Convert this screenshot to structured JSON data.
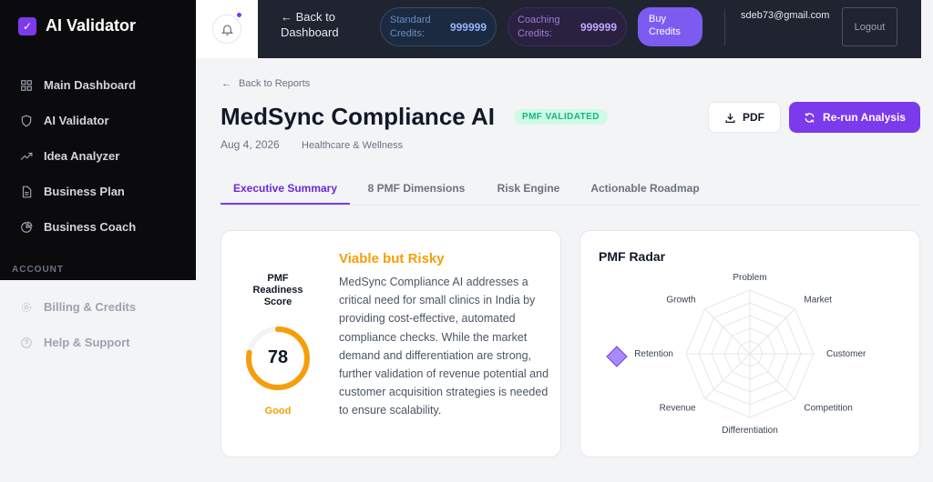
{
  "brand": {
    "name": "AI Validator",
    "logo_icon": "check-icon"
  },
  "sidebar": {
    "items": [
      {
        "label": "Main Dashboard",
        "icon": "grid-icon"
      },
      {
        "label": "AI Validator",
        "icon": "shield-icon"
      },
      {
        "label": "Idea Analyzer",
        "icon": "trend-icon"
      },
      {
        "label": "Business Plan",
        "icon": "document-icon"
      },
      {
        "label": "Business Coach",
        "icon": "pie-icon"
      }
    ],
    "section_label": "ACCOUNT",
    "account_items": [
      {
        "label": "Billing & Credits",
        "icon": "gear-icon"
      },
      {
        "label": "Help & Support",
        "icon": "help-icon"
      }
    ]
  },
  "header": {
    "back_label": "← Back to Dashboard",
    "standard_credits_label": "Standard Credits:",
    "standard_credits_value": "999999",
    "coaching_credits_label": "Coaching Credits:",
    "coaching_credits_value": "999999",
    "buy_label": "Buy Credits",
    "email": "sdeb73@gmail.com",
    "logout_label": "Logout"
  },
  "report": {
    "back_label": "Back to Reports",
    "title": "MedSync Compliance AI",
    "badge": "PMF VALIDATED",
    "date": "Aug 4, 2026",
    "category": "Healthcare & Wellness",
    "pdf_label": "PDF",
    "rerun_label": "Re-run Analysis"
  },
  "tabs": [
    {
      "label": "Executive Summary",
      "active": true
    },
    {
      "label": "8 PMF Dimensions",
      "active": false
    },
    {
      "label": "Risk Engine",
      "active": false
    },
    {
      "label": "Actionable Roadmap",
      "active": false
    }
  ],
  "summary": {
    "score_title": "PMF Readiness Score",
    "score": 78,
    "score_max": 100,
    "score_label": "Good",
    "verdict": "Viable but Risky",
    "text": "MedSync Compliance AI addresses a critical need for small clinics in India by providing cost-effective, automated compliance checks. While the market demand and differentiation are strong, further validation of revenue potential and customer acquisition strategies is needed to ensure scalability."
  },
  "radar": {
    "title": "PMF Radar",
    "axes": [
      "Problem",
      "Market",
      "Customer",
      "Competition",
      "Differentiation",
      "Revenue",
      "Retention",
      "Growth"
    ]
  },
  "colors": {
    "accent": "#7c3aed",
    "warning": "#f59e0b",
    "success": "#10b981",
    "sidebar_bg": "#0b0b0d",
    "topbar_bg": "#1f2430"
  }
}
